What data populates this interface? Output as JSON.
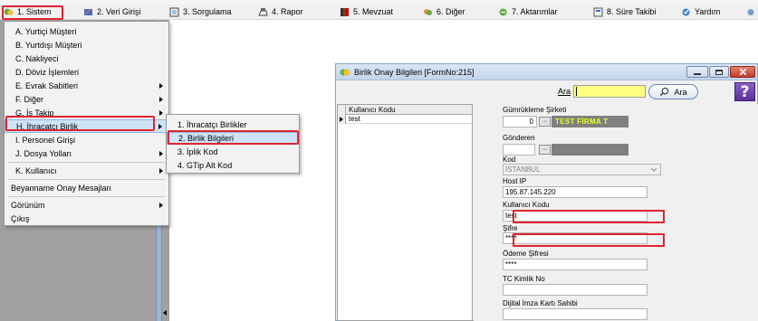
{
  "menubar": {
    "items": [
      {
        "label": "1.  Sistem",
        "icon": "sistem-icon"
      },
      {
        "label": "2.  Veri Girişi",
        "icon": "veri-girisi-icon"
      },
      {
        "label": "3.  Sorgulama",
        "icon": "sorgulama-icon"
      },
      {
        "label": "4.  Rapor",
        "icon": "rapor-icon"
      },
      {
        "label": "5.  Mevzuat",
        "icon": "mevzuat-icon"
      },
      {
        "label": "6.  Diğer",
        "icon": "diger-icon"
      },
      {
        "label": "7.  Aktarımlar",
        "icon": "aktarimlar-icon"
      },
      {
        "label": "8. Süre Takibi",
        "icon": "sure-takibi-icon"
      },
      {
        "label": "Yardım",
        "icon": "yardim-icon"
      }
    ]
  },
  "sistem_menu": {
    "items": [
      {
        "label": "A.  Yurtiçi Müşteri",
        "submenu": false
      },
      {
        "label": "B.  Yurtdışı Müşteri",
        "submenu": false
      },
      {
        "label": "C.  Nakliyeci",
        "submenu": false
      },
      {
        "label": "D.  Döviz İşlemleri",
        "submenu": false
      },
      {
        "label": "E.  Evrak Sabitleri",
        "submenu": true
      },
      {
        "label": "F.  Diğer",
        "submenu": true
      },
      {
        "label": "G.  İş Takip",
        "submenu": true
      },
      {
        "label": "H.  İhracatçı Birlik",
        "submenu": true
      },
      {
        "label": "I.  Personel Girişi",
        "submenu": false
      },
      {
        "label": "J.  Dosya Yolları",
        "submenu": true
      },
      {
        "label": "K.  Kullanıcı",
        "submenu": true
      },
      {
        "label": "Beyanname Onay Mesajları",
        "submenu": false
      },
      {
        "label": "Görünüm",
        "submenu": true
      },
      {
        "label": "Çıkış",
        "submenu": false
      }
    ]
  },
  "birlik_submenu": {
    "items": [
      {
        "label": "1.  İhracatçı Birlikler"
      },
      {
        "label": "2.  Birlik Bilgileri"
      },
      {
        "label": "3.  İplik Kod"
      },
      {
        "label": "4.  GTip Alt Kod"
      }
    ]
  },
  "dialog": {
    "title": "Birlik Onay Bilgileri [FormNo:215]",
    "search_label": "Ara",
    "search_value": "",
    "search_button": "Ara",
    "help_label": "?",
    "grid": {
      "column_header": "Kullanıcı Kodu",
      "rows": [
        "test"
      ]
    },
    "form": {
      "gumrukleme_label": "Gümrükleme Şirketi",
      "gumrukleme_code": "0",
      "gumrukleme_name": "TEST FİRMA T",
      "gonderen_label": "Gönderen",
      "kod_label": "Kod",
      "kod_value": "İSTANBUL",
      "host_label": "Host IP",
      "host_value": "195.87.145.220",
      "kullanici_label": "Kullanıcı Kodu",
      "kullanici_value": "test",
      "sifre_label": "Şifre",
      "sifre_value": "****",
      "odeme_label": "Ödeme Şifresi",
      "odeme_value": "****",
      "tc_label": "TC Kimlik No",
      "tc_value": "",
      "dijital_label": "Dijital İmza Kartı Sahibi",
      "dijital_value": ""
    }
  },
  "colors": {
    "highlight": "#e0242f",
    "firma_text": "#e8ff26",
    "search_bg": "#ffff80"
  }
}
